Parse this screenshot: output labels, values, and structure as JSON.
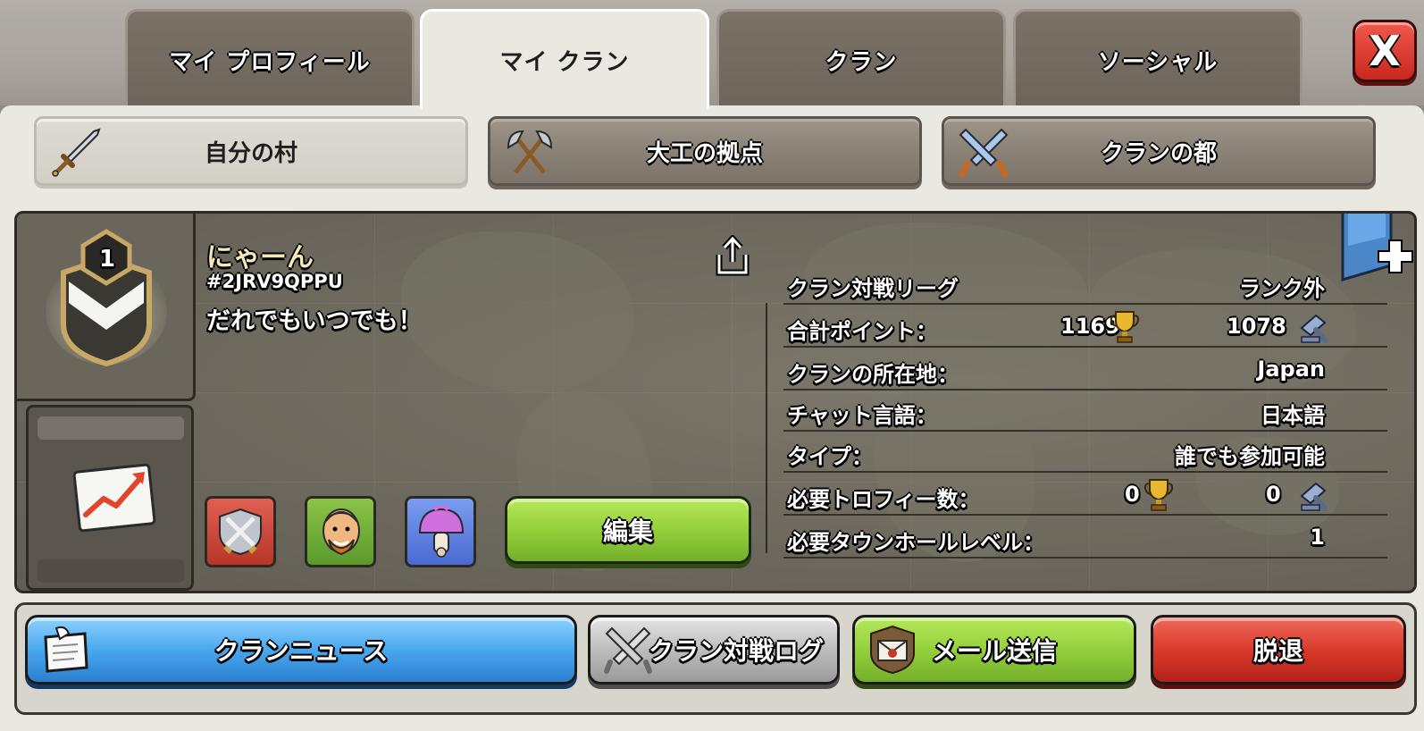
{
  "tabs": [
    "マイ プロフィール",
    "マイ クラン",
    "クラン",
    "ソーシャル"
  ],
  "active_tab": "マイ クラン",
  "close_label": "X",
  "subtabs": [
    "自分の村",
    "大工の拠点",
    "クランの都"
  ],
  "clan": {
    "level": "1",
    "name": "にゃーん",
    "tag": "#2JRV9QPPU",
    "description": "だれでもいつでも！"
  },
  "stats": {
    "league_label": "クラン対戦リーグ",
    "league_value": "ランク外",
    "points_label": "合計ポイント：",
    "points_home": "1169",
    "points_builder": "1078",
    "location_label": "クランの所在地：",
    "location_value": "Japan",
    "chat_label": "チャット言語：",
    "chat_value": "日本語",
    "type_label": "タイプ：",
    "type_value": "誰でも参加可能",
    "req_trophies_label": "必要トロフィー数：",
    "req_trophies_home": "0",
    "req_trophies_builder": "0",
    "req_th_label": "必要タウンホールレベル：",
    "req_th_value": "1"
  },
  "edit_label": "編集",
  "bottom_buttons": {
    "news": "クランニュース",
    "war_log": "クラン対戦ログ",
    "mail": "メール送信",
    "leave": "脱退"
  },
  "colors": {
    "panel_bg": "#e9e8e1",
    "info_bg": "#6d695e",
    "accent_green": "#94d03c",
    "accent_blue": "#49a8ee",
    "accent_red": "#d83a2c"
  },
  "icons": [
    "sword-icon",
    "axes-icon",
    "crossed-swords-icon",
    "clan-badge-icon",
    "share-icon",
    "trophy-icon",
    "builder-hammer-icon",
    "banner-plus-icon",
    "stats-chart-icon",
    "war-perk-icon",
    "barbarian-perk-icon",
    "mushroom-perk-icon",
    "note-icon",
    "mail-icon"
  ]
}
